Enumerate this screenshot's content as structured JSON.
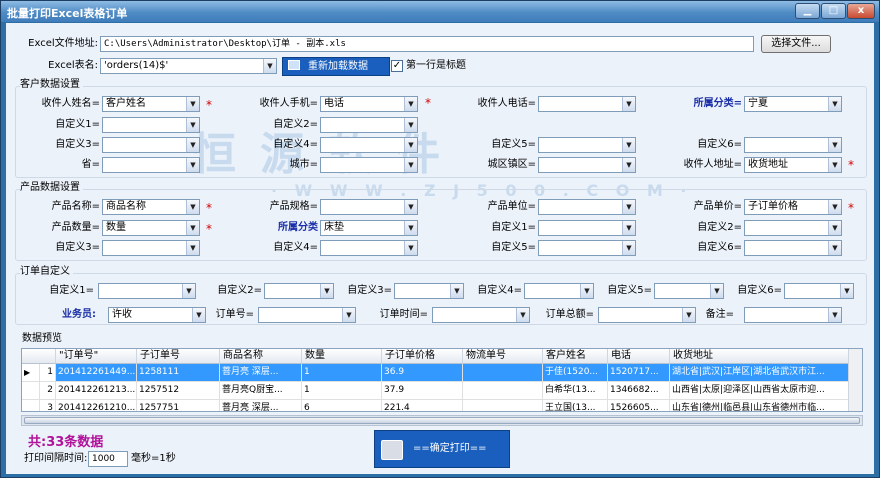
{
  "window": {
    "title": "批量打印Excel表格订单",
    "min": "▁",
    "max": "□",
    "close": "x"
  },
  "watermark": {
    "main": "恒源软件",
    "url": "· W W W . Z J 5 0 0 . C O M ·"
  },
  "file": {
    "label": "Excel文件地址:",
    "value": "C:\\Users\\Administrator\\Desktop\\订单 - 副本.xls",
    "browse": "选择文件..."
  },
  "sheet": {
    "label": "Excel表名:",
    "value": "'orders(14)$'",
    "reload": "重新加载数据",
    "first_row_label": "第一行是标题",
    "first_row_checked": "✓"
  },
  "customer": {
    "title": "客户数据设置",
    "recv_name": {
      "label": "收件人姓名=",
      "value": "客户姓名"
    },
    "recv_mobile": {
      "label": "收件人手机=",
      "value": "电话"
    },
    "recv_phone": {
      "label": "收件人电话=",
      "value": ""
    },
    "category": {
      "label": "所属分类=",
      "value": "宁夏"
    },
    "c1": {
      "label": "自定义1=",
      "value": ""
    },
    "c2": {
      "label": "自定义2=",
      "value": ""
    },
    "c3": {
      "label": "自定义3=",
      "value": ""
    },
    "c4": {
      "label": "自定义4=",
      "value": ""
    },
    "c5": {
      "label": "自定义5=",
      "value": ""
    },
    "c6": {
      "label": "自定义6=",
      "value": ""
    },
    "province": {
      "label": "省=",
      "value": ""
    },
    "city": {
      "label": "城市=",
      "value": ""
    },
    "district": {
      "label": "城区镇区=",
      "value": ""
    },
    "address": {
      "label": "收件人地址=",
      "value": "收货地址"
    }
  },
  "product": {
    "title": "产品数据设置",
    "name": {
      "label": "产品名称=",
      "value": "商品名称"
    },
    "spec": {
      "label": "产品规格=",
      "value": ""
    },
    "unit": {
      "label": "产品单位=",
      "value": ""
    },
    "price": {
      "label": "产品单价=",
      "value": "子订单价格"
    },
    "qty": {
      "label": "产品数量=",
      "value": "数量"
    },
    "category": {
      "label": "所属分类",
      "value": "床垫"
    },
    "c1": {
      "label": "自定义1=",
      "value": ""
    },
    "c2": {
      "label": "自定义2=",
      "value": ""
    },
    "c3": {
      "label": "自定义3=",
      "value": ""
    },
    "c4": {
      "label": "自定义4=",
      "value": ""
    },
    "c5": {
      "label": "自定义5=",
      "value": ""
    },
    "c6": {
      "label": "自定义6=",
      "value": ""
    }
  },
  "order": {
    "title": "订单自定义",
    "c1": {
      "label": "自定义1=",
      "value": ""
    },
    "c2": {
      "label": "自定义2=",
      "value": ""
    },
    "c3": {
      "label": "自定义3=",
      "value": ""
    },
    "c4": {
      "label": "自定义4=",
      "value": ""
    },
    "c5": {
      "label": "自定义5=",
      "value": ""
    },
    "c6": {
      "label": "自定义6=",
      "value": ""
    },
    "salesman": {
      "label": "业务员:",
      "value": "许收"
    },
    "order_no": {
      "label": "订单号=",
      "value": ""
    },
    "order_time": {
      "label": "订单时间=",
      "value": ""
    },
    "order_total": {
      "label": "订单总额=",
      "value": ""
    },
    "remark": {
      "label": "备注=",
      "value": ""
    }
  },
  "preview": {
    "title": "数据预览",
    "columns": [
      "\"订单号\"",
      "子订单号",
      "商品名称",
      "数量",
      "子订单价格",
      "物流单号",
      "客户姓名",
      "电话",
      "收货地址"
    ],
    "rows": [
      {
        "marker": "▶",
        "num": "1",
        "cells": [
          "201412261449...",
          "1258111",
          "菩月亮 深层...",
          "1",
          "36.9",
          "",
          "于佳(1520...",
          "1520717...",
          "湖北省|武汉|江岸区|湖北省武汉市江..."
        ]
      },
      {
        "marker": "",
        "num": "2",
        "cells": [
          "201412261213...",
          "1257512",
          "菩月亮Q厨宝...",
          "1",
          "37.9",
          "",
          "白希华(13...",
          "1346682...",
          "山西省|太原|迎泽区|山西省太原市迎..."
        ]
      },
      {
        "marker": "",
        "num": "3",
        "cells": [
          "201412261210...",
          "1257751",
          "菩月亮 深层...",
          "6",
          "221.4",
          "",
          "王立国(13...",
          "1526605...",
          "山东省|德州|临邑县|山东省德州市临..."
        ]
      }
    ]
  },
  "footer": {
    "total": "共:33条数据",
    "interval_label": "打印间隔时间:",
    "interval_value": "1000",
    "interval_unit": "毫秒=1秒",
    "print": "==确定打印=="
  }
}
